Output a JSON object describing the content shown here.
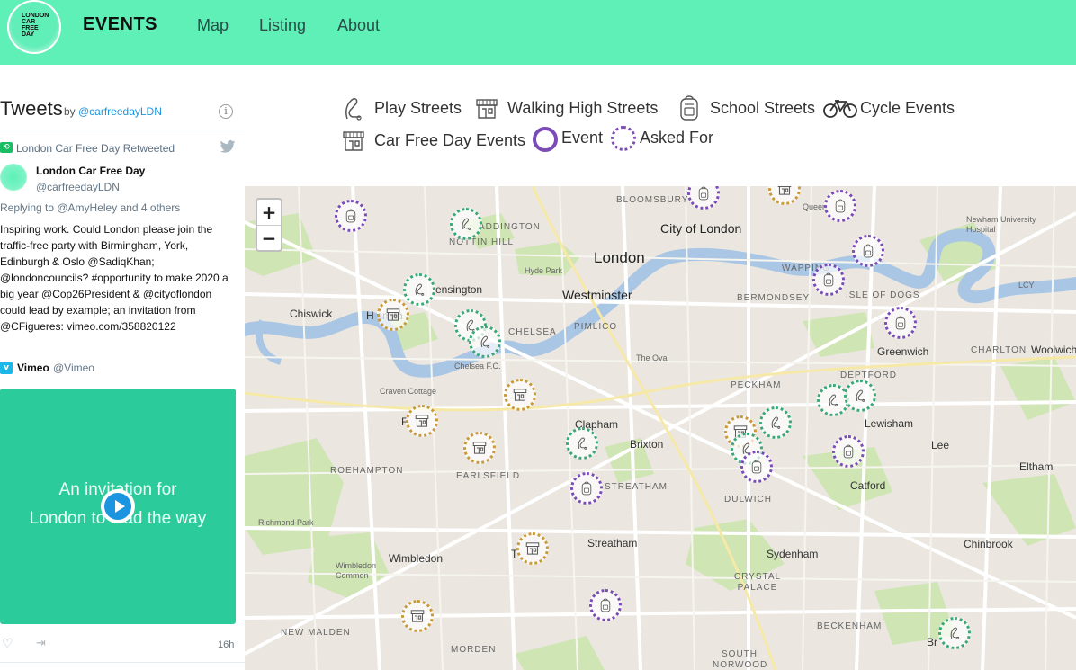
{
  "header": {
    "logo_text": "LONDON CAR FREE DAY",
    "brand": "EVENTS",
    "nav": [
      "Map",
      "Listing",
      "About"
    ]
  },
  "tweets": {
    "title": "Tweets",
    "by": "by",
    "handle": "@carfreedayLDN",
    "retweet_label": "London Car Free Day Retweeted",
    "author_name": "London Car Free Day",
    "author_handle": "@carfreedayLDN",
    "reply_to": "Replying to @AmyHeley and 4 others",
    "lines": [
      "Inspiring work. Could London please join the",
      "traffic-free party with Birmingham, York,",
      "Edinburgh & Oslo @SadiqKhan;",
      "@londoncouncils? #opportunity to make 2020 a",
      "big year @Cop26President & @cityoflondon",
      " could lead by example; an invitation from",
      "@CFigueres: vimeo.com/358820122"
    ],
    "vimeo_name": "Vimeo",
    "vimeo_handle": "@Vimeo",
    "video_line1": "An invitation for",
    "video_line2": "London to lead the way",
    "time": "16h"
  },
  "legend": {
    "play_streets": "Play Streets",
    "walking_high_streets": "Walking High Streets",
    "school_streets": "School Streets",
    "cycle_events": "Cycle Events",
    "car_free_day_events": "Car Free Day Events",
    "event": "Event",
    "asked_for": "Asked For",
    "colors": {
      "purple": "#7b4bb7",
      "green": "#3aa878",
      "gold": "#c99a3a"
    }
  },
  "map": {
    "zoom_in": "+",
    "zoom_out": "−",
    "places": {
      "london": "London",
      "westminster": "Westminster",
      "city_of_london": "City of London",
      "bloomsbury": "BLOOMSBURY",
      "paddington": "ADDINGTON",
      "notting_hill": "NOTTIN HILL",
      "hyde_park": "Hyde Park",
      "kensington": "ensington",
      "chiswick": "Chiswick",
      "hammersmith": "H          smith",
      "chelsea": "CHELSEA",
      "chelsea_fc": "Chelsea F.C.",
      "pimlico": "PIMLICO",
      "the_oval": "The Oval",
      "craven_cottage": "Craven Cottage",
      "wapping": "WAPPING",
      "bermondsey": "BERMONDSEY",
      "isle_of_dogs": "ISLE OF DOGS",
      "queen": "Queen",
      "newham_hospital": "Newham University Hospital",
      "lcy": "LCY",
      "greenwich": "Greenwich",
      "charlton": "CHARLTON",
      "woolwich": "Woolwich",
      "deptford": "DEPTFORD",
      "peckham": "PECKHAM",
      "lewisham": "Lewisham",
      "clapham": "Clapham",
      "brixton": "Brixton",
      "lee": "Lee",
      "eltham": "Eltham",
      "roehampton": "ROEHAMPTON",
      "earlsfield": "EARLSFIELD",
      "streatham_caps": "STREATHAM",
      "dulwich": "DULWICH",
      "catford": "Catford",
      "richmond_park": "Richmond Park",
      "wimbledon_common": "Wimbledon Common",
      "wimbledon": "Wimbledon",
      "streatham": "Streatham",
      "sydenham": "Sydenham",
      "chinbrook": "Chinbrook",
      "crystal_palace": "CRYSTAL PALACE",
      "new_malden": "NEW MALDEN",
      "morden": "MORDEN",
      "south_norwood": "SOUTH NORWOOD",
      "beckenham": "BECKENHAM",
      "bromley": "Br",
      "tooting": "T",
      "fulham": "F"
    }
  }
}
